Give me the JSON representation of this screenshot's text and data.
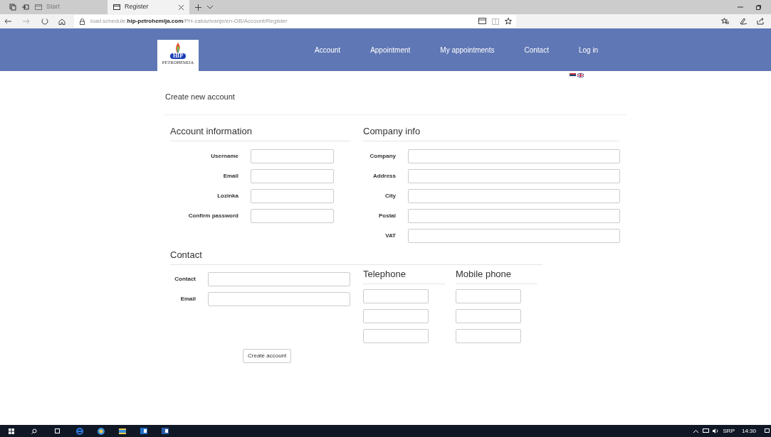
{
  "browser": {
    "tabs": [
      {
        "label": "Start",
        "selected": false
      },
      {
        "label": "Register",
        "selected": true
      }
    ],
    "url": "load.schedule.**hip-petrohemija.com**/PH-zakazivanje/en-GB/Account/Register"
  },
  "logo": {
    "badge": "HIP",
    "name": "PETROHEMIJA"
  },
  "nav": [
    "Account",
    "Appointment",
    "My appointments",
    "Contact",
    "Log in"
  ],
  "page_title": "Create new account",
  "account_information": {
    "title": "Account information",
    "fields": [
      "Username",
      "Email",
      "Lozinka",
      "Confirm password"
    ]
  },
  "company_info": {
    "title": "Company info",
    "fields": [
      "Company",
      "Address",
      "City",
      "Postal",
      "VAT"
    ]
  },
  "contact": {
    "title": "Contact",
    "fields": [
      "Contact",
      "Email"
    ]
  },
  "telephone": {
    "title": "Telephone",
    "inputs": [
      {
        "kind": "text"
      },
      {
        "kind": "text"
      },
      {
        "kind": "text"
      }
    ]
  },
  "mobile_phone": {
    "title": "Mobile phone",
    "inputs": [
      {
        "kind": "text"
      },
      {
        "kind": "text"
      },
      {
        "kind": "text"
      }
    ]
  },
  "submit": "Create account",
  "taskbar": {
    "language": "SRP",
    "time": "14:30"
  }
}
